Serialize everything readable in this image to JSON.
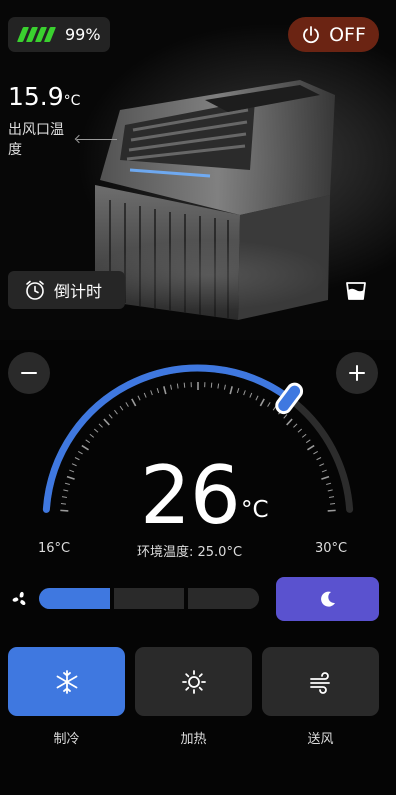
{
  "status": {
    "battery_percent": "99%",
    "power_label": "OFF",
    "accent_green": "#3ad12f",
    "power_color": "#6b2413"
  },
  "outlet": {
    "temp_value": "15.9",
    "temp_unit": "°C",
    "label": "出风口温度"
  },
  "timer": {
    "label": "倒计时",
    "icon": "alarm-clock-icon"
  },
  "dial": {
    "set_temp": "26",
    "set_unit": "°C",
    "min_label": "16°C",
    "max_label": "30°C",
    "min_value": 16,
    "max_value": 30,
    "current_value": 26,
    "ambient_label": "环境温度: 25.0°C",
    "accent_color": "#3f78e0"
  },
  "fan": {
    "levels": 3,
    "active_level": 1,
    "icon": "fan-icon",
    "sleep_icon": "moon-icon",
    "sleep_color": "#5a52cf"
  },
  "modes": [
    {
      "label": "制冷",
      "icon": "snowflake-icon",
      "active": true
    },
    {
      "label": "加热",
      "icon": "sun-icon",
      "active": false
    },
    {
      "label": "送风",
      "icon": "wind-icon",
      "active": false
    }
  ]
}
